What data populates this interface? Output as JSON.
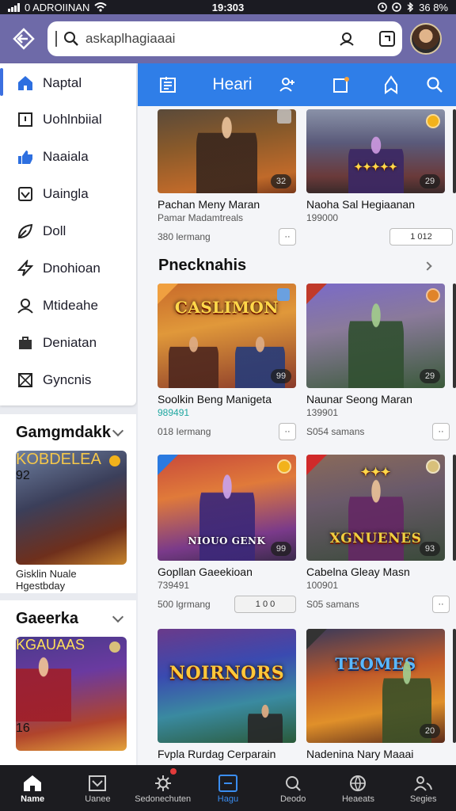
{
  "status_bar": {
    "carrier": "0 ADROIINAN",
    "time": "19:303",
    "battery": "36 8%"
  },
  "search": {
    "value": "askaplhagiaaai"
  },
  "sidebar": {
    "items": [
      {
        "label": "Naptal",
        "icon": "home-icon"
      },
      {
        "label": "Uohlnbiial",
        "icon": "book-icon"
      },
      {
        "label": "Naaiala",
        "icon": "thumb-up-icon"
      },
      {
        "label": "Uaingla",
        "icon": "heart-box-icon"
      },
      {
        "label": "Doll",
        "icon": "leaf-icon"
      },
      {
        "label": "Dnohioan",
        "icon": "bolt-icon"
      },
      {
        "label": "Mtideahe",
        "icon": "person-icon"
      },
      {
        "label": "Deniatan",
        "icon": "bag-icon"
      },
      {
        "label": "Gyncnis",
        "icon": "grid-x-icon"
      }
    ],
    "section1": {
      "title": "Gamgmdakk",
      "art_title": "KOBDELEA",
      "count": "92",
      "caption": "Gisklin Nuale Hgestbday"
    },
    "section2": {
      "title": "Gaeerka",
      "art_title": "KGAUAAS",
      "count": "16"
    }
  },
  "tabs": {
    "active_label": "Heari"
  },
  "row1": [
    {
      "title": "Pachan Meny Maran",
      "sub": "Pamar Madamtreals",
      "meta": "380 lermang",
      "count": "32",
      "pill": "··"
    },
    {
      "title": "Naoha Sal Hegiaanan",
      "sub": "199000",
      "meta": "",
      "count": "29",
      "pill": "1   012"
    }
  ],
  "section_heading": "Pnecknahis",
  "row2": [
    {
      "title": "Soolkin Beng Manigeta",
      "sub": "989491",
      "meta": "018 Iermang",
      "count": "99",
      "art_title": "CASLIMON",
      "pill": "··"
    },
    {
      "title": "Naunar Seong Maran",
      "sub": "139901",
      "meta": "S054 samans",
      "count": "29",
      "art_title": "",
      "pill": "··"
    }
  ],
  "row3": [
    {
      "title": "Gopllan Gaeekioan",
      "sub": "739491",
      "meta": "500 lgrmang",
      "count": "99",
      "art_title": "NIOUO GENK",
      "pill": "1   0 0"
    },
    {
      "title": "Cabelna Gleay Masn",
      "sub": "100901",
      "meta": "S05 samans",
      "count": "93",
      "art_title": "XGNUENES",
      "pill": "··"
    }
  ],
  "row4": [
    {
      "title": "Fvpla Rurdag Cerparain",
      "art_title": "NOIRNORS"
    },
    {
      "title": "Nadenina Nary Maaai",
      "count": "20",
      "art_title": "TEOMES"
    }
  ],
  "bottom_nav": [
    {
      "label": "Name",
      "icon": "home-icon"
    },
    {
      "label": "Uanee",
      "icon": "inbox-icon"
    },
    {
      "label": "Sedonechuten",
      "icon": "gear-icon"
    },
    {
      "label": "Hagu",
      "icon": "card-icon"
    },
    {
      "label": "Deodo",
      "icon": "search-doc-icon"
    },
    {
      "label": "Heaeats",
      "icon": "globe-icon"
    },
    {
      "label": "Segies",
      "icon": "people-icon"
    }
  ],
  "colors": {
    "accent": "#2f7ee8",
    "topbar": "#6e6aa8",
    "nav_bg": "#1c1c20"
  }
}
